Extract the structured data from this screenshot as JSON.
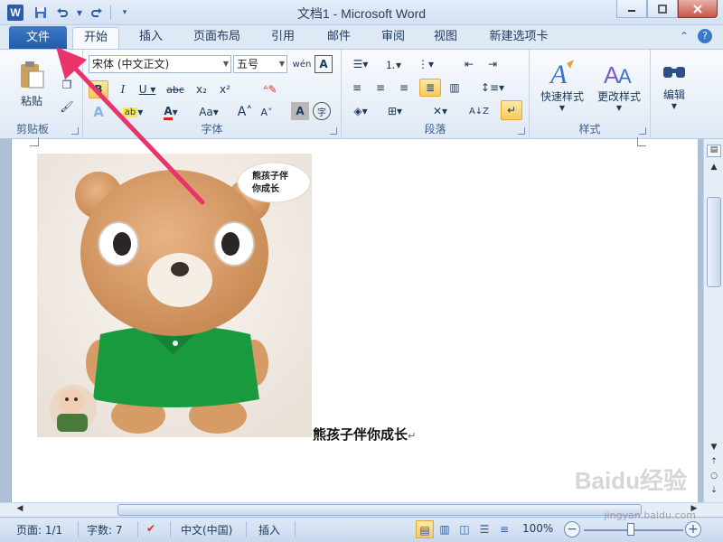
{
  "window": {
    "title": "文档1 - Microsoft Word",
    "logo": "W",
    "minimize_icon": "minimize-icon",
    "restore_icon": "restore-icon",
    "close_icon": "close-icon"
  },
  "tabs": {
    "file": "文件",
    "items": [
      "开始",
      "插入",
      "页面布局",
      "引用",
      "邮件",
      "审阅",
      "视图",
      "新建选项卡"
    ],
    "active": "开始"
  },
  "ribbon": {
    "clipboard": {
      "label": "剪贴板",
      "paste": "粘贴"
    },
    "font": {
      "label": "字体",
      "font_name": "宋体 (中文正文)",
      "font_size": "五号"
    },
    "paragraph": {
      "label": "段落"
    },
    "styles": {
      "label": "样式",
      "quick_styles": "快速样式",
      "change_styles": "更改样式"
    },
    "editing": {
      "label": "编辑"
    }
  },
  "document": {
    "badge_line1": "熊孩子伴",
    "badge_line2": "你成长",
    "caption": "熊孩子伴你成长",
    "paragraph_mark": "↵"
  },
  "status": {
    "page": "页面: 1/1",
    "words": "字数: 7",
    "language": "中文(中国)",
    "mode": "插入",
    "zoom": "100%"
  },
  "watermark": {
    "brand": "Baidu经验",
    "url": "jingyan.baidu.com"
  },
  "colors": {
    "file_tab": "#2a64b4",
    "arrow": "#e8336b",
    "shirt": "#1a9a3f",
    "bear": "#d9a070"
  }
}
